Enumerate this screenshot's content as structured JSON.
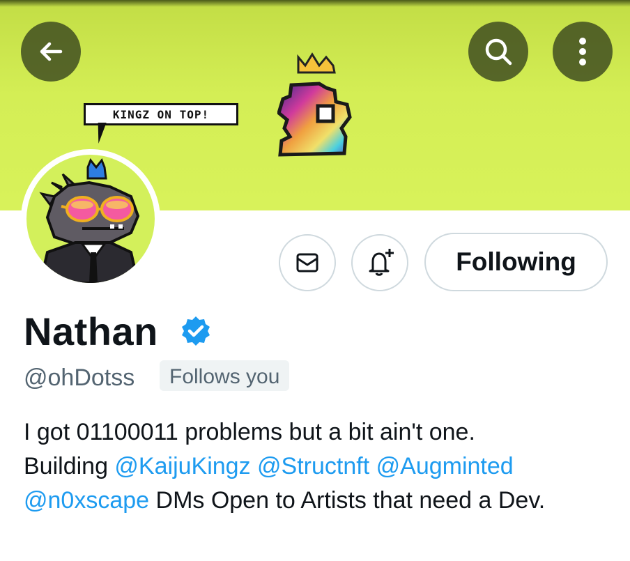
{
  "header": {
    "back_icon": "arrow-left-icon",
    "search_icon": "search-icon",
    "more_icon": "more-vertical-icon",
    "banner_speech_text": "KINGZ ON TOP!",
    "banner_color": "#d4ee55"
  },
  "actions": {
    "message_icon": "envelope-icon",
    "notify_icon": "bell-plus-icon",
    "following_label": "Following"
  },
  "profile": {
    "name": "Nathan",
    "verified": true,
    "handle": "@ohDotss",
    "follows_you_label": "Follows you"
  },
  "bio": {
    "line1": "I got 01100011 problems but a bit ain't one.",
    "building_prefix": "Building ",
    "mentions": [
      "@KaijuKingz",
      "@Structnft",
      "@Augminted",
      "@n0xscape"
    ],
    "suffix": " DMs Open to Artists that need a Dev."
  },
  "colors": {
    "accent": "#1d9bf0",
    "text": "#0f1419",
    "muted": "#536471"
  }
}
